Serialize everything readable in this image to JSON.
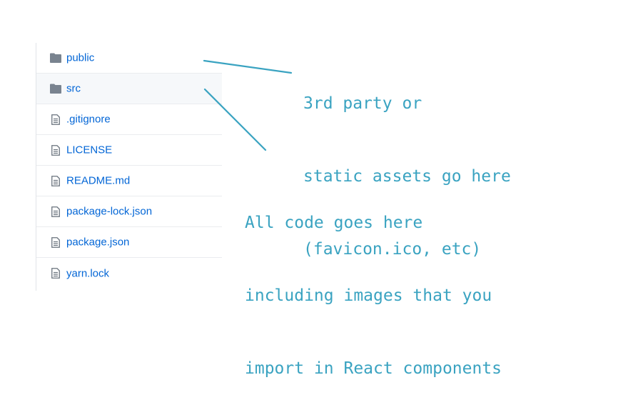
{
  "files": [
    {
      "name": "public",
      "icon": "folder-icon",
      "type": "dir"
    },
    {
      "name": "src",
      "icon": "folder-icon",
      "type": "dir"
    },
    {
      "name": ".gitignore",
      "icon": "file-text-icon",
      "type": "file"
    },
    {
      "name": "LICENSE",
      "icon": "file-text-icon",
      "type": "file"
    },
    {
      "name": "README.md",
      "icon": "file-text-icon",
      "type": "file"
    },
    {
      "name": "package-lock.json",
      "icon": "file-text-icon",
      "type": "file"
    },
    {
      "name": "package.json",
      "icon": "file-text-icon",
      "type": "file"
    },
    {
      "name": "yarn.lock",
      "icon": "file-text-icon",
      "type": "file"
    }
  ],
  "annotations": {
    "public_note": [
      "3rd party or",
      "static assets go here",
      "(favicon.ico, etc)"
    ],
    "src_note": [
      "All code goes here",
      "including images that you",
      "import in React components"
    ]
  },
  "colors": {
    "link": "#0366d6",
    "annotation": "#3aa3c1",
    "folder_icon": "#79838f",
    "file_icon": "#6a737d",
    "row_hover": "#f6f8fa",
    "border": "#eaecef"
  }
}
